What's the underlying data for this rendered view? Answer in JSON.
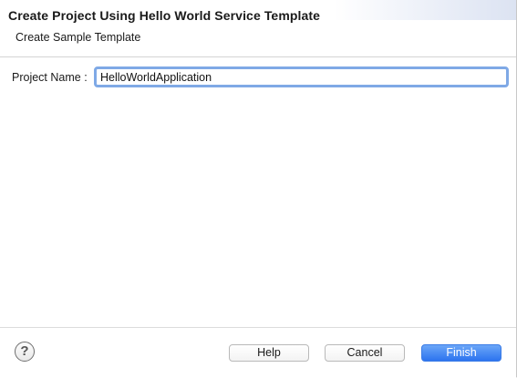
{
  "header": {
    "title": "Create Project Using Hello World Service Template",
    "subtitle": "Create Sample Template"
  },
  "form": {
    "project_name_label": "Project Name :",
    "project_name_value": "HelloWorldApplication"
  },
  "footer": {
    "help_icon": "question-mark-icon",
    "help_glyph": "?",
    "help_label": "Help",
    "cancel_label": "Cancel",
    "finish_label": "Finish"
  },
  "colors": {
    "focus_ring": "#7fa9e6",
    "primary_button": "#2c73ef"
  }
}
